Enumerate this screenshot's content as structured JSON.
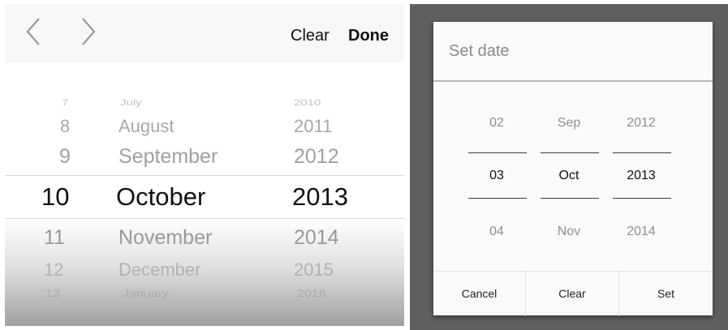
{
  "ios_picker": {
    "clear_label": "Clear",
    "done_label": "Done",
    "prev_icon": "chevron-left-icon",
    "next_icon": "chevron-right-icon",
    "days": [
      "7",
      "8",
      "9",
      "10",
      "11",
      "12",
      "13"
    ],
    "months": [
      "July",
      "August",
      "September",
      "October",
      "November",
      "December",
      "January"
    ],
    "years": [
      "2010",
      "2011",
      "2012",
      "2013",
      "2014",
      "2015",
      "2016"
    ],
    "selected": {
      "day": "10",
      "month": "October",
      "year": "2013"
    }
  },
  "android_dialog": {
    "title": "Set date",
    "columns": [
      {
        "prev": "02",
        "current": "03",
        "next": "04"
      },
      {
        "prev": "Sep",
        "current": "Oct",
        "next": "Nov"
      },
      {
        "prev": "2012",
        "current": "2013",
        "next": "2014"
      }
    ],
    "buttons": {
      "cancel": "Cancel",
      "clear": "Clear",
      "set": "Set"
    }
  }
}
